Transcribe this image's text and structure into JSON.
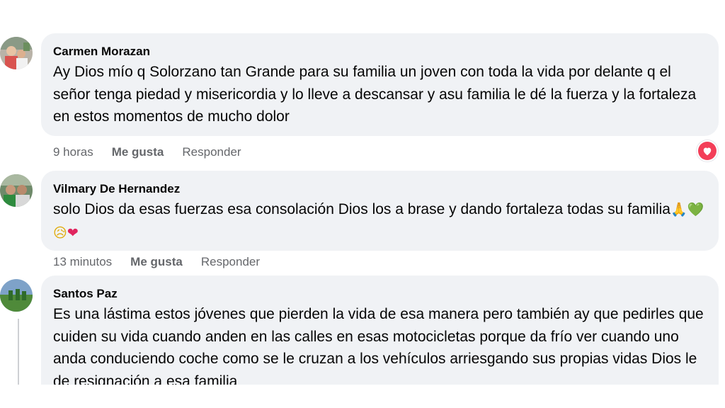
{
  "comments": [
    {
      "author": "Carmen Morazan",
      "text": "Ay Dios mío q Solorzano tan Grande para su familia un joven con toda la vida por delante q el señor tenga piedad y misericordia y lo lleve a descansar y asu familia le dé la fuerza y la fortaleza en estos momentos de mucho dolor",
      "time": "9 horas",
      "like_label": "Me gusta",
      "reply_label": "Responder",
      "reaction_icon": "heart-reaction-icon",
      "reaction_color": "#f33e58"
    },
    {
      "author": "Vilmary De Hernandez",
      "text": "solo Dios da esas fuerzas esa consolación Dios los a brase y dando fortaleza todas su familia",
      "emojis": [
        "🙏",
        "💚",
        "😥",
        "❤"
      ],
      "time": "13 minutos",
      "like_label": "Me gusta",
      "reply_label": "Responder"
    },
    {
      "author": "Santos Paz",
      "text": "Es una lástima estos jóvenes que pierden la vida de esa manera pero también ay que pedirles que cuiden su vida cuando anden en las calles en esas motocicletas porque da frío ver cuando uno anda conduciendo coche como se le cruzan a los vehículos arriesgando sus propias vidas Dios le de resignación a esa familia"
    }
  ],
  "colors": {
    "bubble_bg": "#f0f2f5",
    "meta_text": "#65676b",
    "body_text": "#050505"
  }
}
